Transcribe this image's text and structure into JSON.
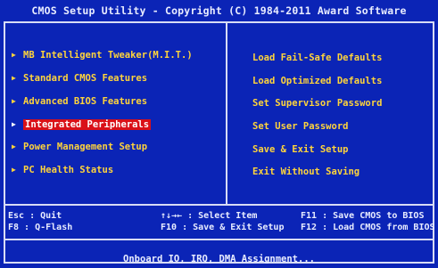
{
  "title": "CMOS Setup Utility - Copyright (C) 1984-2011 Award Software",
  "left_menu": [
    {
      "label": "MB Intelligent Tweaker(M.I.T.)"
    },
    {
      "label": "Standard CMOS Features"
    },
    {
      "label": "Advanced BIOS Features"
    },
    {
      "label": "Integrated Peripherals"
    },
    {
      "label": "Power Management Setup"
    },
    {
      "label": "PC Health Status"
    }
  ],
  "selected_index": 3,
  "right_menu": [
    {
      "label": "Load Fail-Safe Defaults"
    },
    {
      "label": "Load Optimized Defaults"
    },
    {
      "label": "Set Supervisor Password"
    },
    {
      "label": "Set User Password"
    },
    {
      "label": "Save & Exit Setup"
    },
    {
      "label": "Exit Without Saving"
    }
  ],
  "keys": {
    "esc": "Esc : Quit",
    "f8": "F8  : Q-Flash",
    "select": "↑↓→← : Select Item",
    "f10": "F10 : Save & Exit Setup",
    "f11": "F11 : Save CMOS to BIOS",
    "f12": "F12 : Load CMOS from BIOS"
  },
  "help_text": "Onboard IO, IRQ, DMA Assignment...",
  "colors": {
    "background": "#0b24b6",
    "menu_text": "#ffd43b",
    "highlight": "#d91018",
    "frame": "#d8dcf5"
  },
  "icons": {
    "menu_marker": "triangle-right-icon"
  }
}
